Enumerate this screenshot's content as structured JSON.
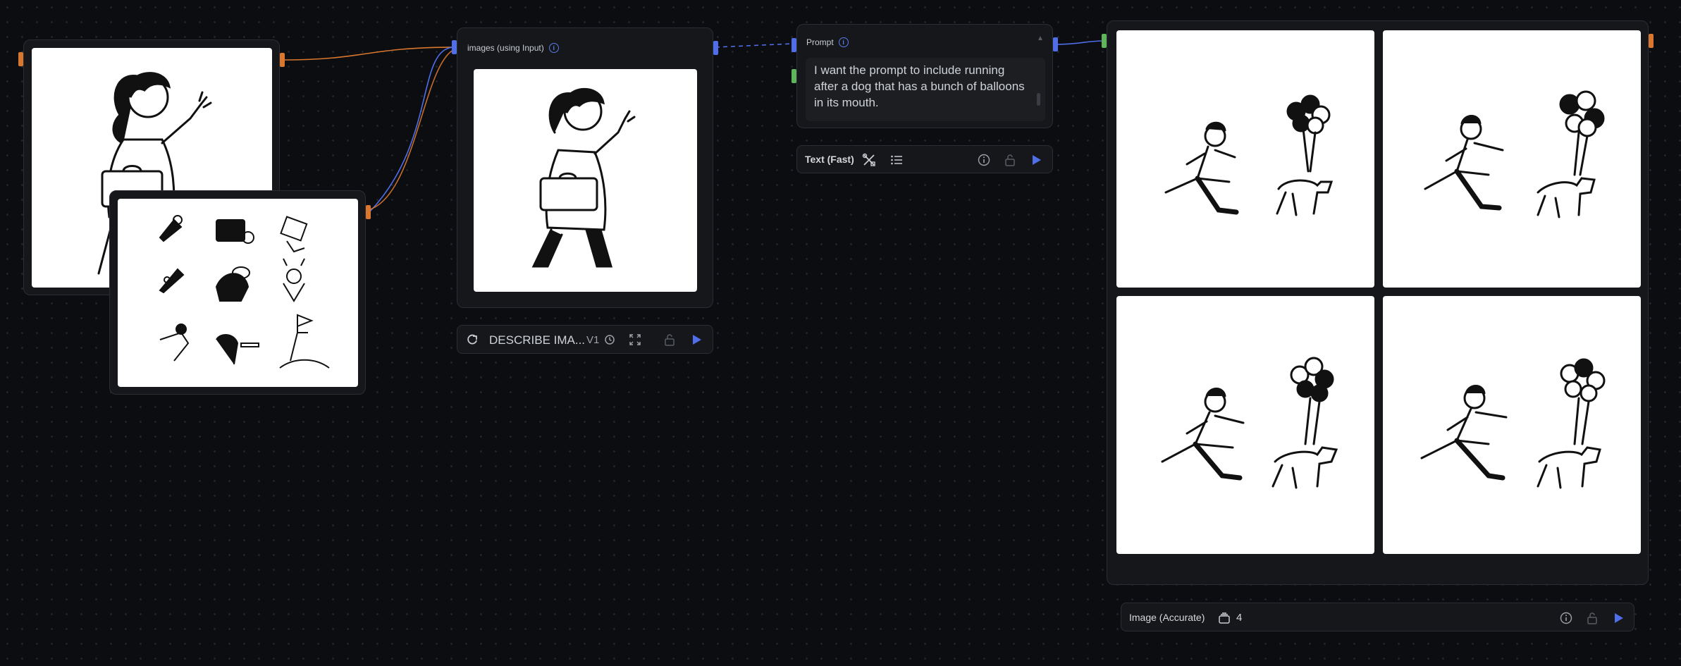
{
  "nodes": {
    "images_input": {
      "header": "images (using Input)"
    },
    "prompt": {
      "header": "Prompt",
      "text": "I want the prompt to include running after a dog that has a bunch of balloons in its mouth."
    }
  },
  "toolbars": {
    "describe": {
      "label": "DESCRIBE IMA...",
      "version": "V1"
    },
    "text_fast": {
      "label": "Text (Fast)"
    },
    "image_accurate": {
      "label": "Image (Accurate)",
      "count": "4"
    }
  },
  "colors": {
    "background": "#0c0d10",
    "node_bg": "#15171b",
    "node_border": "#2a2d33",
    "accent_blue": "#4f6ee8",
    "port_orange": "#d9772f",
    "port_green": "#5fb55a"
  },
  "icons": [
    "refresh-icon",
    "history-icon",
    "expand-icon",
    "lock-icon",
    "play-icon",
    "tools-icon",
    "list-icon",
    "info-icon",
    "stack-icon"
  ]
}
